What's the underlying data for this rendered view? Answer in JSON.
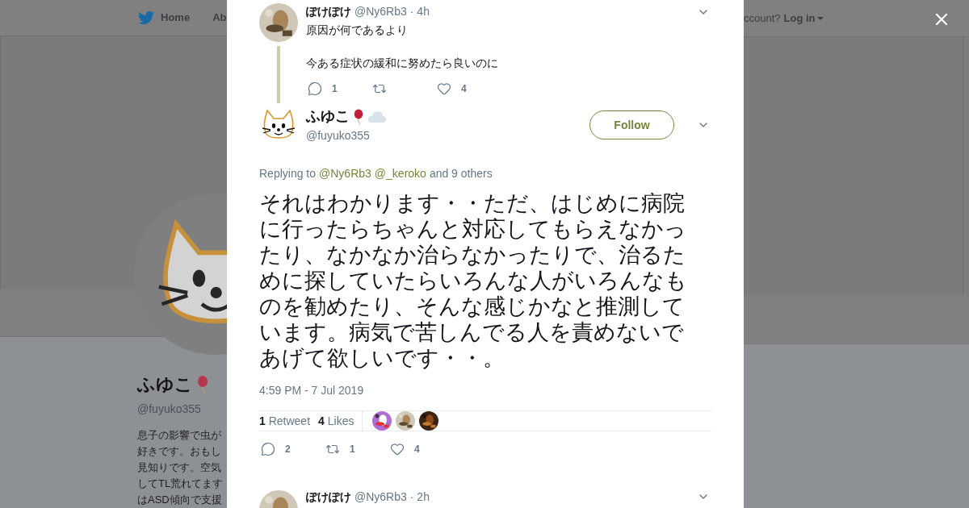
{
  "background_page": {
    "nav": [
      {
        "label": "Home",
        "kind": "home"
      },
      {
        "label": "Ab",
        "kind": "plain"
      }
    ],
    "login_prompt": "ccount?",
    "login_link": "Log in",
    "profile": {
      "name": "ふゆこ",
      "handle": "@fuyuko355",
      "bio_lines": [
        "息子の影響で虫が",
        "好きです。おもし",
        "見知りです。空気",
        "してTL荒れてます",
        "はASD傾向で支援"
      ]
    }
  },
  "modal": {
    "parent_tweet": {
      "name": "ぽけぽけ",
      "handle": "@Ny6Rb3",
      "time": "· 4h",
      "paragraphs": [
        "原因が何であるより",
        "今ある症状の緩和に努めたら良いのに"
      ],
      "actions": [
        {
          "kind": "reply",
          "count": "1"
        },
        {
          "kind": "retweet"
        },
        {
          "kind": "like",
          "count": "4"
        }
      ]
    },
    "main_tweet": {
      "name": "ふゆこ",
      "handle": "@fuyuko355",
      "follow": "Follow",
      "replying_prefix": "Replying to",
      "mentions": [
        "@Ny6Rb3",
        "@_keroko"
      ],
      "others": "and 9 others",
      "text": "それはわかります・・ただ、はじめに病院に行ったらちゃんと対応してもらえなかったり、なかなか治らなかったりで、治るために探していたらいろんな人がいろんなものを勧めたり、そんな感じかなと推測しています。病気で苦しんでる人を責めないであげて欲しいです・・。",
      "timestamp": "4:59 PM - 7 Jul 2019",
      "stats": [
        {
          "count": "1",
          "label": "Retweet"
        },
        {
          "count": "4",
          "label": "Likes"
        }
      ],
      "likers": [
        {
          "kind": "picture"
        },
        {
          "kind": "picture"
        },
        {
          "kind": "picture"
        }
      ],
      "actions": [
        {
          "kind": "reply",
          "count": "2"
        },
        {
          "kind": "retweet",
          "count": "1"
        },
        {
          "kind": "like",
          "count": "4"
        }
      ]
    },
    "next_tweet": {
      "name": "ぽけぽけ",
      "handle": "@Ny6Rb3",
      "time": "· 2h"
    }
  }
}
